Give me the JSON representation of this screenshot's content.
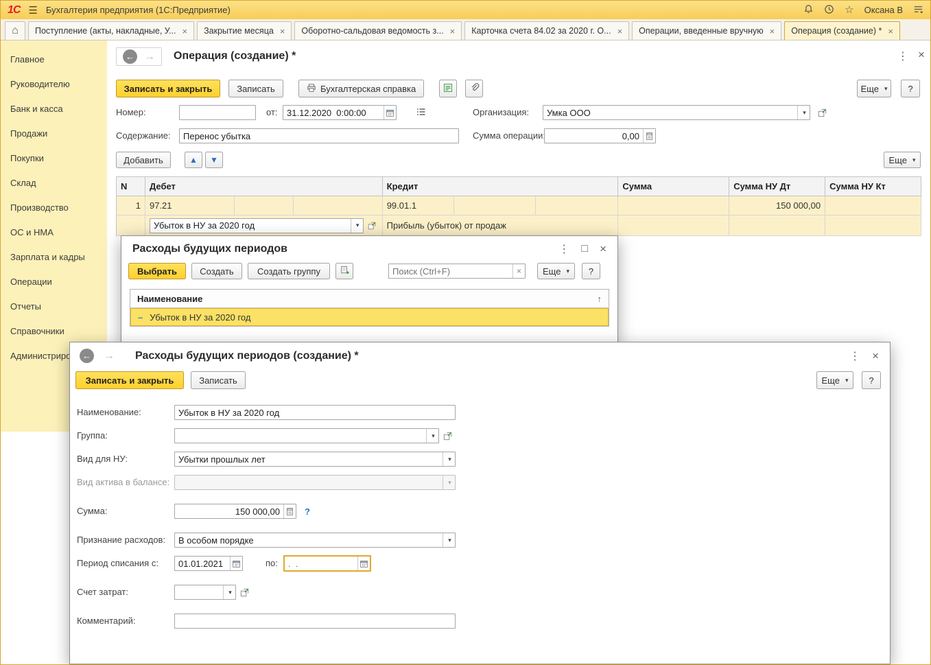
{
  "titlebar": {
    "logo": "1С",
    "title": "Бухгалтерия предприятия  (1С:Предприятие)",
    "user": "Оксана В"
  },
  "tabs": {
    "items": [
      {
        "label": "Поступление (акты, накладные, У..."
      },
      {
        "label": "Закрытие месяца"
      },
      {
        "label": "Оборотно-сальдовая ведомость з..."
      },
      {
        "label": "Карточка счета 84.02 за 2020 г. О..."
      },
      {
        "label": "Операции, введенные вручную"
      },
      {
        "label": "Операция (создание) *"
      }
    ]
  },
  "sidebar": {
    "items": [
      "Главное",
      "Руководителю",
      "Банк и касса",
      "Продажи",
      "Покупки",
      "Склад",
      "Производство",
      "ОС и НМА",
      "Зарплата и кадры",
      "Операции",
      "Отчеты",
      "Справочники",
      "Администрирование"
    ]
  },
  "operation_form": {
    "title": "Операция (создание) *",
    "toolbar": {
      "save_close": "Записать и закрыть",
      "save": "Записать",
      "accounting_reference": "Бухгалтерская справка",
      "more": "Еще",
      "help": "?"
    },
    "fields": {
      "number_label": "Номер:",
      "number_value": "",
      "date_label": "от:",
      "date_value": "31.12.2020  0:00:00",
      "organization_label": "Организация:",
      "organization_value": "Умка ООО",
      "content_label": "Содержание:",
      "content_value": "Перенос убытка",
      "amount_label": "Сумма операции:",
      "amount_value": "0,00"
    },
    "commands": {
      "add": "Добавить",
      "more": "Еще"
    },
    "table": {
      "headers": {
        "n": "N",
        "debit": "Дебет",
        "credit": "Кредит",
        "amount": "Сумма",
        "amount_nu_dt": "Сумма НУ Дт",
        "amount_nu_kt": "Сумма НУ Кт"
      },
      "row1": {
        "n": "1",
        "debit_account": "97.21",
        "credit_account": "99.01.1",
        "amount_nu_dt": "150 000,00"
      },
      "row2": {
        "debit_subconto": "Убыток в НУ за 2020 год",
        "credit_subconto": "Прибыль (убыток) от продаж"
      }
    }
  },
  "rbp_list_dialog": {
    "title": "Расходы будущих периодов",
    "toolbar": {
      "select": "Выбрать",
      "create": "Создать",
      "create_group": "Создать группу",
      "search_placeholder": "Поиск (Ctrl+F)",
      "more": "Еще",
      "help": "?"
    },
    "list": {
      "column": "Наименование",
      "selected_item": "Убыток в НУ за 2020 год"
    }
  },
  "rbp_create_dialog": {
    "title": "Расходы будущих периодов (создание) *",
    "toolbar": {
      "save_close": "Записать и закрыть",
      "save": "Записать",
      "more": "Еще",
      "help": "?"
    },
    "fields": {
      "name": {
        "label": "Наименование:",
        "value": "Убыток в НУ за 2020 год"
      },
      "group": {
        "label": "Группа:",
        "value": ""
      },
      "nu_kind": {
        "label": "Вид для НУ:",
        "value": "Убытки прошлых лет"
      },
      "balance_asset_kind": {
        "label": "Вид актива в балансе:",
        "value": ""
      },
      "amount": {
        "label": "Сумма:",
        "value": "150 000,00",
        "hint": "?"
      },
      "recognition": {
        "label": "Признание расходов:",
        "value": "В особом порядке"
      },
      "period_from": {
        "label": "Период списания с:",
        "value": "01.01.2021"
      },
      "period_to": {
        "label": "по:",
        "placeholder": ".  ."
      },
      "cost_account": {
        "label": "Счет затрат:",
        "value": ""
      },
      "comment": {
        "label": "Комментарий:",
        "value": ""
      }
    }
  },
  "icons": {
    "close": "×",
    "kebab": "⋮",
    "maximize": "□",
    "back": "←",
    "forward": "→",
    "dropdown": "▾",
    "hamburger": "☰",
    "home": "⌂",
    "sort_asc": "↑",
    "dash": "–",
    "star": "☆",
    "up": "▲",
    "down": "▼"
  },
  "colors": {
    "accent_yellow": "#ffd633",
    "titlebar_yellow": "#f9d05e",
    "sidebar_yellow": "#fcf1b8",
    "selection_cream": "#fcf0c9",
    "selection_yellow": "#fbe165",
    "logo_red": "#e31e24"
  }
}
